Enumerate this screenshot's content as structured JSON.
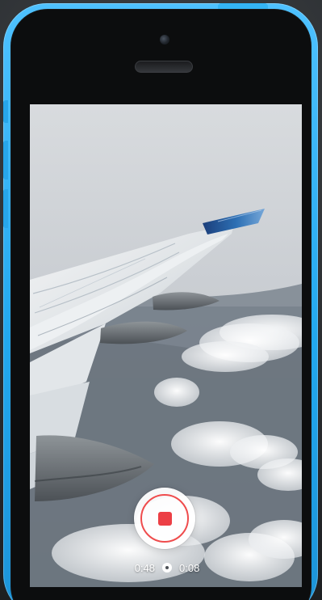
{
  "recording": {
    "elapsed": "0:48",
    "remaining": "0:08"
  },
  "icons": {
    "record": "stop-icon",
    "timer_separator": "dot-icon"
  },
  "colors": {
    "phone_shell": "#22a8ee",
    "record_accent": "#ec3f45",
    "record_button_bg": "#ffffff",
    "timer_text": "#ffffff"
  }
}
